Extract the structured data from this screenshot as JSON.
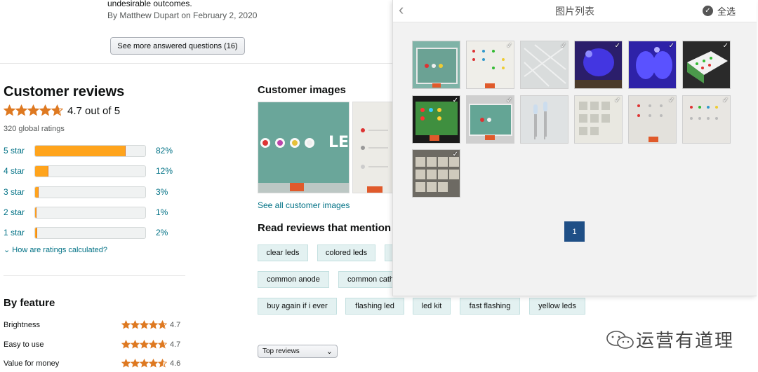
{
  "answer": {
    "text": "undesirable outcomes.",
    "byline": "By Matthew Dupart on February 2, 2020"
  },
  "see_more_button": "See more answered questions (16)",
  "reviews": {
    "title": "Customer reviews",
    "rating": 4.7,
    "rating_text": "4.7 out of 5",
    "global_ratings": "320 global ratings",
    "histogram": [
      {
        "label": "5 star",
        "percent": 82,
        "percent_text": "82%"
      },
      {
        "label": "4 star",
        "percent": 12,
        "percent_text": "12%"
      },
      {
        "label": "3 star",
        "percent": 3,
        "percent_text": "3%"
      },
      {
        "label": "2 star",
        "percent": 1,
        "percent_text": "1%"
      },
      {
        "label": "1 star",
        "percent": 2,
        "percent_text": "2%"
      }
    ],
    "how_calculated": "How are ratings calculated?"
  },
  "by_feature": {
    "title": "By feature",
    "items": [
      {
        "name": "Brightness",
        "rating": 4.7,
        "value": "4.7"
      },
      {
        "name": "Easy to use",
        "rating": 4.7,
        "value": "4.7"
      },
      {
        "name": "Value for money",
        "rating": 4.6,
        "value": "4.6"
      }
    ]
  },
  "customer_images": {
    "title": "Customer images",
    "see_all": "See all customer images"
  },
  "mentions": {
    "title": "Read reviews that mention",
    "chips": [
      "clear leds",
      "colored leds",
      "common anode",
      "common cath",
      "buy again if i ever",
      "flashing led",
      "led kit",
      "fast flashing",
      "yellow leds"
    ]
  },
  "sort": {
    "selected": "Top reviews"
  },
  "panel": {
    "title": "图片列表",
    "select_all": "全选",
    "page": "1",
    "image_count": 13
  },
  "watermark": "运营有道理",
  "colors": {
    "star": "#de7921",
    "bar_fill": "#ffa41c",
    "link": "#007185",
    "chip_bg": "#e3f1f1",
    "pager": "#1f4f86"
  }
}
